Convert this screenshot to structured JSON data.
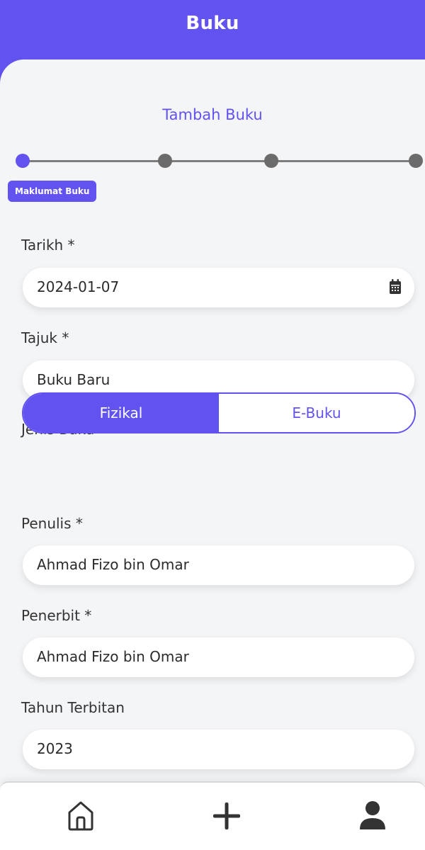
{
  "header": {
    "title": "Buku"
  },
  "form": {
    "title": "Tambah Buku",
    "stepper": {
      "steps": 4,
      "active_index": 0,
      "active_label": "Maklumat Buku"
    },
    "fields": {
      "tarikh": {
        "label": "Tarikh *",
        "value": "2024-01-07",
        "icon": "calendar-icon"
      },
      "tajuk": {
        "label": "Tajuk *",
        "value": "Buku Baru"
      },
      "jenis_buku": {
        "label": "Jenis Buku *",
        "options": [
          "Fizikal",
          "E-Buku"
        ],
        "selected": "Fizikal"
      },
      "penulis": {
        "label": "Penulis *",
        "value": "Ahmad Fizo bin Omar"
      },
      "penerbit": {
        "label": "Penerbit *",
        "value": "Ahmad Fizo bin Omar"
      },
      "tahun_terbitan": {
        "label": "Tahun Terbitan",
        "value": "2023"
      }
    }
  },
  "bottom_nav": {
    "items": [
      "home-icon",
      "plus-icon",
      "user-icon"
    ]
  },
  "colors": {
    "accent": "#6253f1",
    "background": "#f4f5f7",
    "field": "#ffffff"
  }
}
